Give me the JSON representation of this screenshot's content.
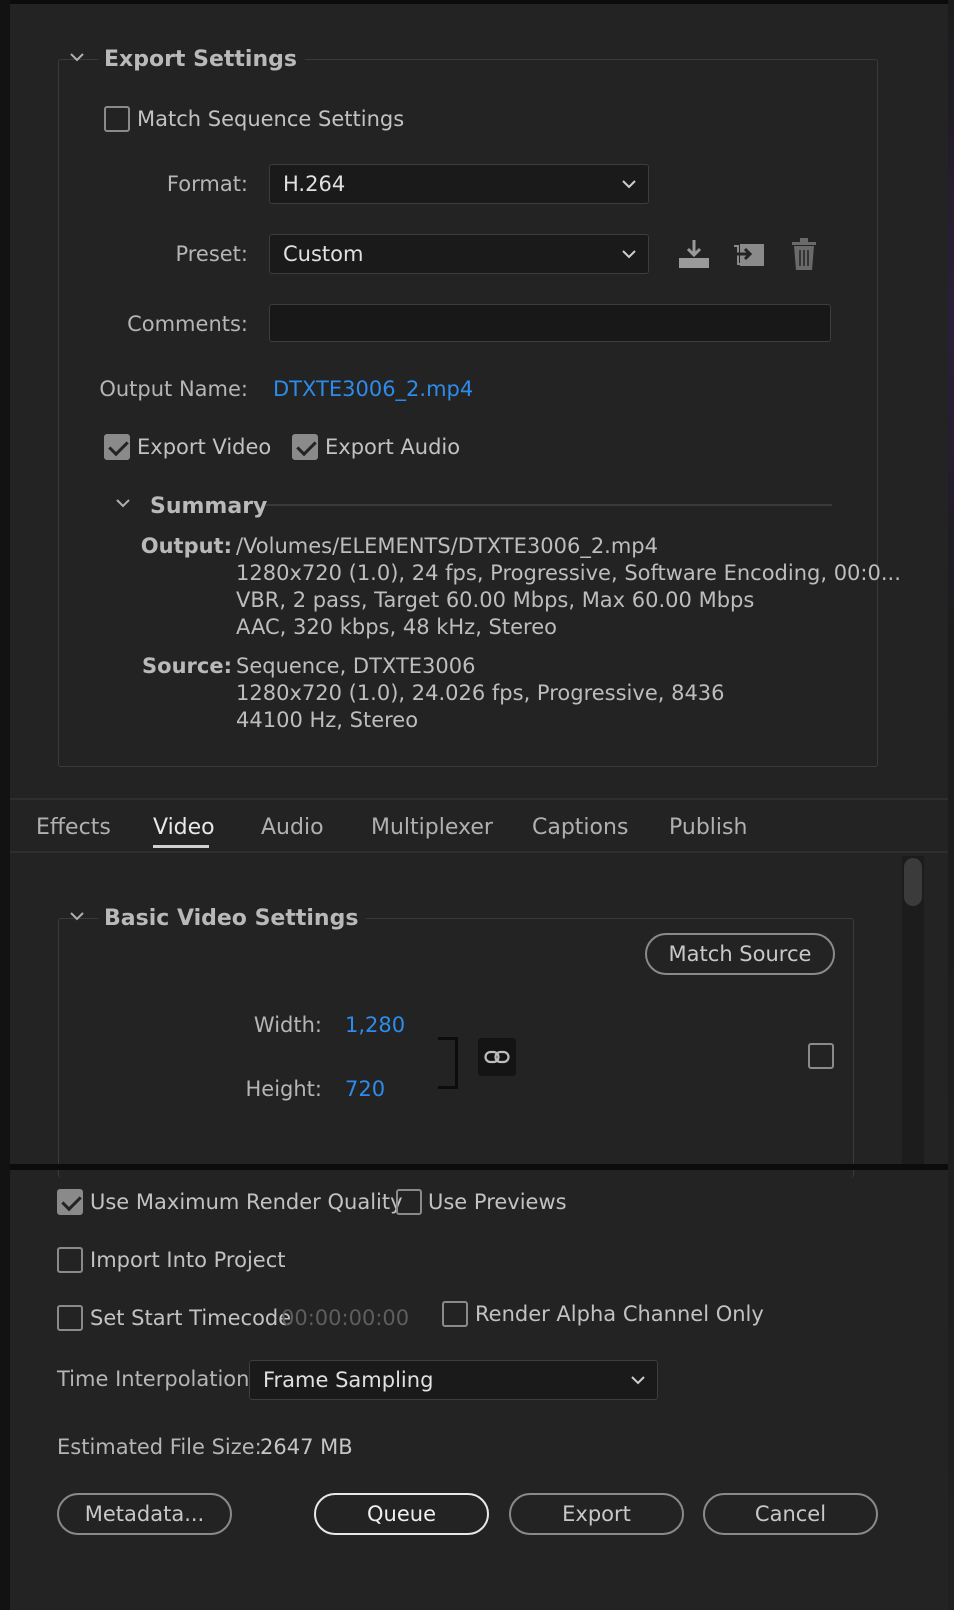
{
  "export_settings": {
    "title": "Export Settings",
    "match_sequence_label": "Match Sequence Settings",
    "match_sequence_checked": false,
    "format_label": "Format:",
    "format_value": "H.264",
    "preset_label": "Preset:",
    "preset_value": "Custom",
    "comments_label": "Comments:",
    "comments_value": "",
    "output_name_label": "Output Name:",
    "output_name_value": "DTXTE3006_2.mp4",
    "export_video_label": "Export Video",
    "export_video_checked": true,
    "export_audio_label": "Export Audio",
    "export_audio_checked": true,
    "icons": [
      "save-preset-icon",
      "import-preset-icon",
      "delete-preset-icon"
    ]
  },
  "summary": {
    "title": "Summary",
    "output_key": "Output:",
    "output_lines": [
      "/Volumes/ELEMENTS/DTXTE3006_2.mp4",
      "1280x720 (1.0), 24 fps, Progressive, Software Encoding, 00:0...",
      "VBR, 2 pass, Target 60.00 Mbps, Max 60.00 Mbps",
      "AAC, 320 kbps, 48 kHz, Stereo"
    ],
    "source_key": "Source:",
    "source_lines": [
      "Sequence, DTXTE3006",
      "1280x720 (1.0), 24.026 fps, Progressive, 8436",
      "44100 Hz, Stereo"
    ]
  },
  "tabs": [
    {
      "label": "Effects",
      "active": false
    },
    {
      "label": "Video",
      "active": true
    },
    {
      "label": "Audio",
      "active": false
    },
    {
      "label": "Multiplexer",
      "active": false
    },
    {
      "label": "Captions",
      "active": false
    },
    {
      "label": "Publish",
      "active": false
    }
  ],
  "basic_video": {
    "title": "Basic Video Settings",
    "match_source_label": "Match Source",
    "width_label": "Width:",
    "width_value": "1,280",
    "height_label": "Height:",
    "height_value": "720",
    "link_icon": "chain-link-icon"
  },
  "footer": {
    "max_render_label": "Use Maximum Render Quality",
    "max_render_checked": true,
    "use_previews_label": "Use Previews",
    "use_previews_checked": false,
    "import_project_label": "Import Into Project",
    "import_project_checked": false,
    "start_timecode_label": "Set Start Timecode",
    "start_timecode_checked": false,
    "start_timecode_value": "00:00:00:00",
    "alpha_only_label": "Render Alpha Channel Only",
    "alpha_only_checked": false,
    "time_interp_label": "Time Interpolation:",
    "time_interp_value": "Frame Sampling",
    "file_size_label": "Estimated File Size:",
    "file_size_value": "2647 MB"
  },
  "buttons": {
    "metadata": "Metadata...",
    "queue": "Queue",
    "export": "Export",
    "cancel": "Cancel"
  },
  "colors": {
    "background": "#232323",
    "accent_link": "#2d8ceb",
    "text": "#c9c9c9"
  }
}
